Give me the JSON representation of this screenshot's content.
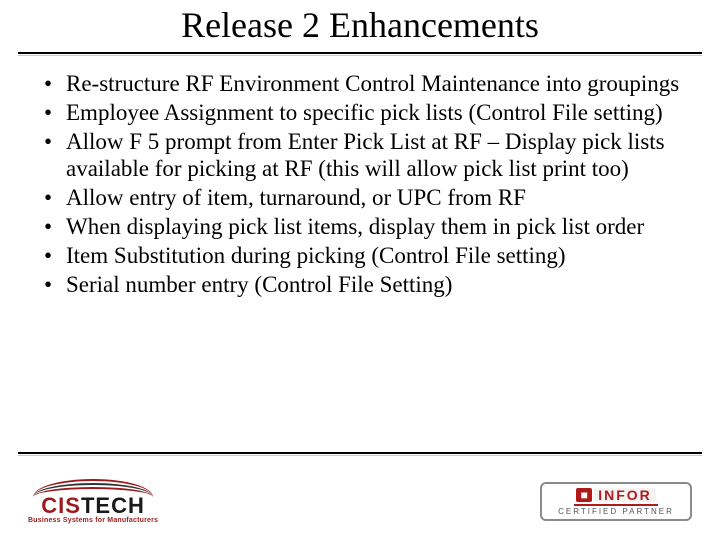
{
  "title": "Release 2 Enhancements",
  "bullets": [
    "Re-structure RF Environment Control Maintenance into groupings",
    "Employee Assignment to specific pick lists (Control File setting)",
    "Allow F 5 prompt from Enter Pick List at RF – Display pick lists available for picking at RF (this will allow pick list print too)",
    "Allow entry of item, turnaround, or UPC from RF",
    "When displaying pick list items, display them in pick list order",
    "Item Substitution during picking (Control File setting)",
    "Serial number entry (Control File Setting)"
  ],
  "logo_left": {
    "word_part1": "CIS",
    "word_part2": "TECH",
    "tagline": "Business Systems for Manufacturers"
  },
  "logo_right": {
    "brand": "INFOR",
    "subtitle": "CERTIFIED PARTNER"
  }
}
